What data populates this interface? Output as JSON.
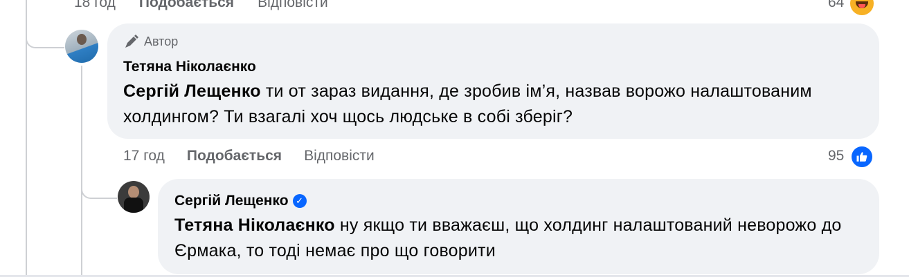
{
  "top_row": {
    "time": "18 год",
    "like_label": "Подобається",
    "reply_label": "Відповісти",
    "reaction_count": "64",
    "reaction_icon": "haha-emoji-icon"
  },
  "comment1": {
    "author_badge": "Автор",
    "author_badge_icon": "pen-icon",
    "author_name": "Тетяна Ніколаєнко",
    "mention": "Сергій Лещенко",
    "text": " ти от зараз видання, де зробив ім’я, назвав ворожо налаштованим холдингом? Ти взагалі хоч щось людське в собі зберіг?",
    "time": "17 год",
    "like_label": "Подобається",
    "reply_label": "Відповісти",
    "reaction_count": "95",
    "reaction_icon": "like-thumb-icon"
  },
  "comment2": {
    "author_name": "Сергій Лещенко",
    "verified_icon": "verified-badge-icon",
    "mention": "Тетяна Ніколаєнко",
    "text": " ну якщо ти вважаєш, що холдинг налаштований неворожо до Єрмака, то тоді немає про що говорити"
  },
  "colors": {
    "bubble": "#f0f2f5",
    "meta_text": "#65676b",
    "accent_blue": "#0866ff",
    "thread_line": "#ced0d4"
  }
}
